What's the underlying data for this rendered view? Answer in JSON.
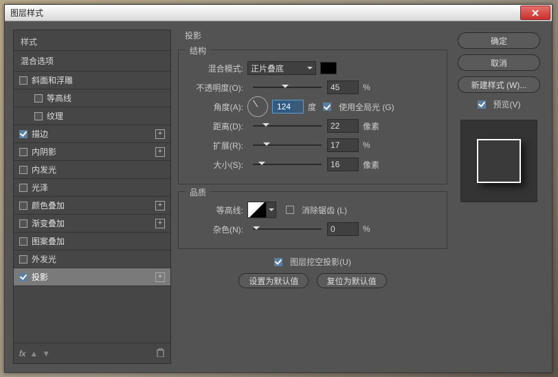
{
  "window": {
    "title": "图层样式"
  },
  "left": {
    "header": "样式",
    "blend_header": "混合选项",
    "items": [
      {
        "label": "斜面和浮雕",
        "checked": false,
        "child": false,
        "plus": false
      },
      {
        "label": "等高线",
        "checked": false,
        "child": true,
        "plus": false
      },
      {
        "label": "纹理",
        "checked": false,
        "child": true,
        "plus": false
      },
      {
        "label": "描边",
        "checked": true,
        "child": false,
        "plus": true
      },
      {
        "label": "内阴影",
        "checked": false,
        "child": false,
        "plus": true
      },
      {
        "label": "内发光",
        "checked": false,
        "child": false,
        "plus": false
      },
      {
        "label": "光泽",
        "checked": false,
        "child": false,
        "plus": false
      },
      {
        "label": "颜色叠加",
        "checked": false,
        "child": false,
        "plus": true
      },
      {
        "label": "渐变叠加",
        "checked": false,
        "child": false,
        "plus": true
      },
      {
        "label": "图案叠加",
        "checked": false,
        "child": false,
        "plus": false
      },
      {
        "label": "外发光",
        "checked": false,
        "child": false,
        "plus": false
      },
      {
        "label": "投影",
        "checked": true,
        "child": false,
        "plus": true,
        "selected": true
      }
    ],
    "footer_fx": "fx"
  },
  "mid": {
    "panel_title": "投影",
    "structure": {
      "title": "结构",
      "blend_mode_label": "混合模式:",
      "blend_mode_value": "正片叠底",
      "opacity_label": "不透明度(O):",
      "opacity_value": "45",
      "opacity_unit": "%",
      "angle_label": "角度(A):",
      "angle_value": "124",
      "angle_unit": "度",
      "global_light": "使用全局光 (G)",
      "distance_label": "距离(D):",
      "distance_value": "22",
      "distance_unit": "像素",
      "spread_label": "扩展(R):",
      "spread_value": "17",
      "spread_unit": "%",
      "size_label": "大小(S):",
      "size_value": "16",
      "size_unit": "像素"
    },
    "quality": {
      "title": "品质",
      "contour_label": "等高线:",
      "antialias": "消除锯齿 (L)",
      "noise_label": "杂色(N):",
      "noise_value": "0",
      "noise_unit": "%"
    },
    "knockout": "图层挖空投影(U)",
    "btn_default": "设置为默认值",
    "btn_reset": "复位为默认值"
  },
  "right": {
    "ok": "确定",
    "cancel": "取消",
    "new_style": "新建样式 (W)...",
    "preview": "预览(V)"
  }
}
